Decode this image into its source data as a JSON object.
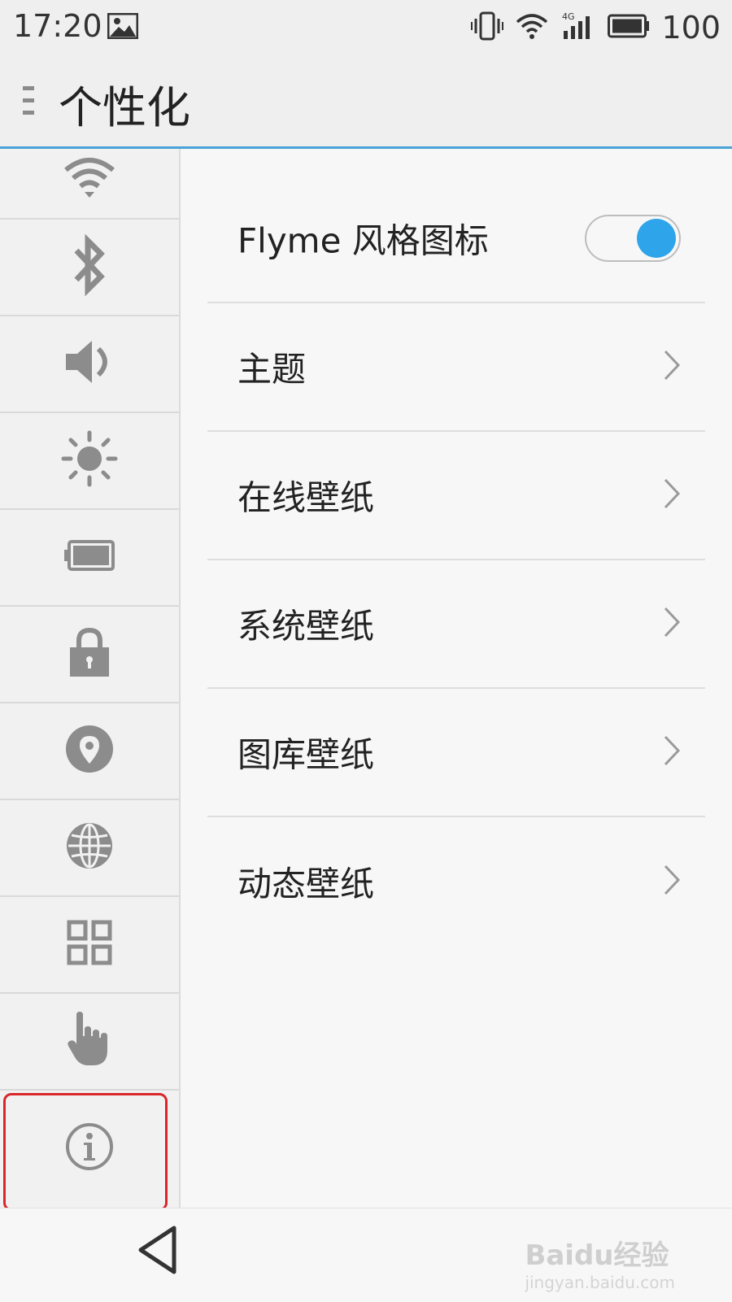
{
  "status": {
    "time": "17:20",
    "battery_percent": "100",
    "network": "4G"
  },
  "header": {
    "title": "个性化"
  },
  "sidebar": {
    "items": [
      {
        "icon": "wifi-icon"
      },
      {
        "icon": "bluetooth-icon"
      },
      {
        "icon": "volume-icon"
      },
      {
        "icon": "brightness-icon"
      },
      {
        "icon": "battery-icon"
      },
      {
        "icon": "lock-icon"
      },
      {
        "icon": "location-icon"
      },
      {
        "icon": "globe-icon"
      },
      {
        "icon": "apps-grid-icon"
      },
      {
        "icon": "gesture-hand-icon"
      },
      {
        "icon": "info-icon"
      }
    ]
  },
  "settings": {
    "flyme_icons": {
      "label": "Flyme 风格图标",
      "enabled": true
    },
    "theme": {
      "label": "主题"
    },
    "online_wallpaper": {
      "label": "在线壁纸"
    },
    "system_wallpaper": {
      "label": "系统壁纸"
    },
    "gallery_wallpaper": {
      "label": "图库壁纸"
    },
    "live_wallpaper": {
      "label": "动态壁纸"
    }
  },
  "watermark": {
    "text": "Baidu经验",
    "sub": "jingyan.baidu.com"
  },
  "colors": {
    "accent": "#2ea4ea",
    "header_line": "#4aa3d8",
    "highlight": "#d9262b",
    "icon_gray": "#8c8c8c"
  }
}
